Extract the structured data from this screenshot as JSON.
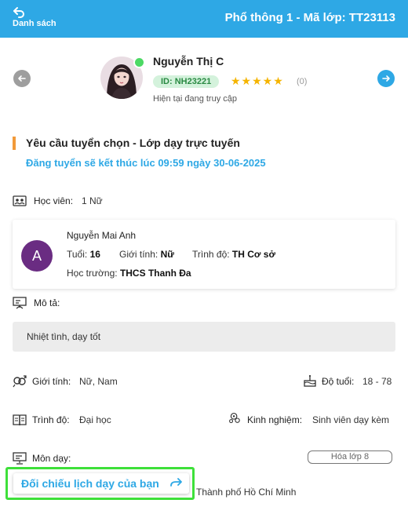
{
  "header": {
    "back_label": "Danh sách",
    "title": "Phổ thông 1 - Mã lớp: TT23113",
    "bg_color": "#2ea8e5"
  },
  "tutor": {
    "name": "Nguyễn Thị C",
    "id_label": "ID: NH23221",
    "stars": "★★★★★",
    "rating_count": "(0)",
    "status": "Hiện tại đang truy cập",
    "online_indicator_color": "#4cd964"
  },
  "request": {
    "title": "Yêu cầu tuyển chọn - Lớp dạy trực tuyến",
    "deadline": "Đăng tuyển sẽ kết thúc lúc 09:59 ngày 30-06-2025",
    "accent_color": "#f29a3a"
  },
  "students_section": {
    "label": "Học viên:",
    "value": "1 Nữ"
  },
  "student": {
    "initial": "A",
    "name": "Nguyễn Mai Anh",
    "age_label": "Tuổi:",
    "age": "16",
    "gender_label": "Giới tính:",
    "gender": "Nữ",
    "level_label": "Trình độ:",
    "level": "TH Cơ sở",
    "school_label": "Học trường:",
    "school": "THCS Thanh Đa"
  },
  "description": {
    "label": "Mô tả:",
    "text": "Nhiệt tình, dạy tốt"
  },
  "requirements": {
    "gender_label": "Giới tính:",
    "gender_value": "Nữ, Nam",
    "age_label": "Độ tuổi:",
    "age_value": "18 - 78",
    "level_label": "Trình độ:",
    "level_value": "Đại học",
    "experience_label": "Kinh nghiệm:",
    "experience_value": "Sinh viên dạy kèm"
  },
  "subjects": {
    "label": "Môn dạy:",
    "chip": "Hóa lớp 8"
  },
  "address": {
    "visible_text": "Thành phố Hồ Chí Minh"
  },
  "compare_button": {
    "label": "Đối chiếu lịch dạy của bạn",
    "highlight_color": "#3ee03a"
  }
}
